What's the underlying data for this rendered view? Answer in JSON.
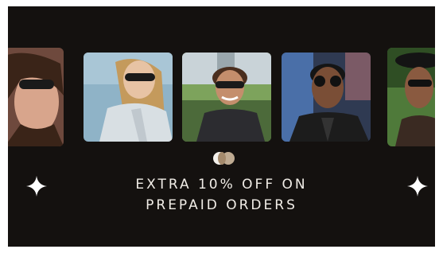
{
  "promo": {
    "line1": "EXTRA 10% OFF ON",
    "line2": "PREPAID ORDERS"
  },
  "carousel": {
    "cards": [
      {
        "name": "model-woman-sunglasses-left"
      },
      {
        "name": "model-woman-blonde-sunglasses"
      },
      {
        "name": "model-man-curly-sunglasses"
      },
      {
        "name": "model-man-round-sunglasses"
      },
      {
        "name": "model-woman-hat-sunglasses-right"
      }
    ],
    "dots": 3
  },
  "colors": {
    "background": "#14110f",
    "text": "#f1ede7",
    "accent": "#c8b49a"
  }
}
